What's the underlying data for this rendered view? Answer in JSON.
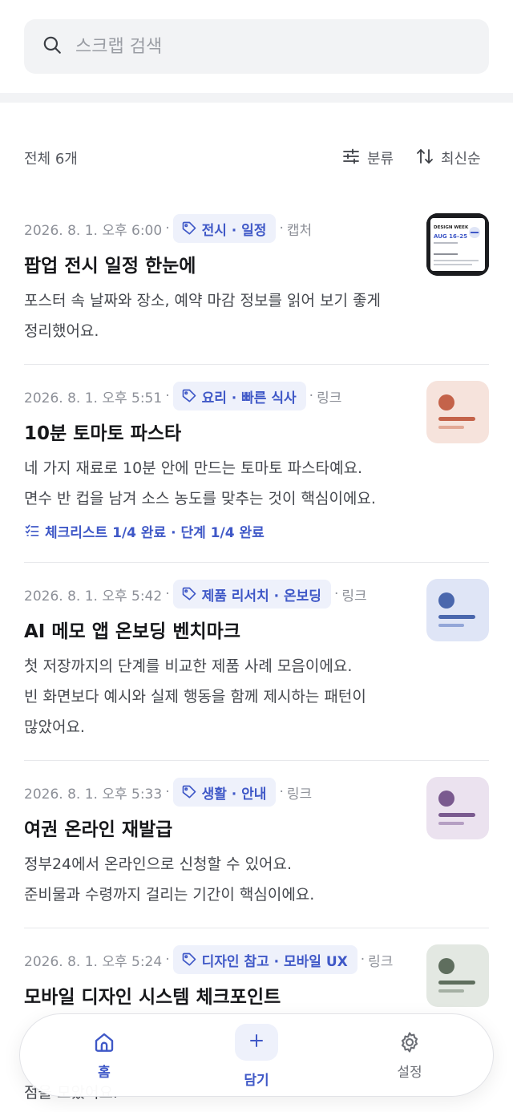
{
  "search": {
    "placeholder": "스크랩 검색"
  },
  "list_header": {
    "total": "전체 6개",
    "filter_label": "분류",
    "sort_label": "최신순"
  },
  "cards": [
    {
      "time": "2026. 8. 1. 오후 6:00",
      "tag": "전시 · 일정",
      "source": "캡처",
      "title": "팝업 전시 일정 한눈에",
      "summary_lines": [
        "포스터 속 날짜와 장소, 예약 마감 정보를 읽어 보기 좋게",
        "정리했어요."
      ],
      "thumb": {
        "kind": "poster",
        "poster_title": "DESIGN WEEK",
        "poster_date": "AUG 16–25"
      }
    },
    {
      "time": "2026. 8. 1. 오후 5:51",
      "tag": "요리 · 빠른 식사",
      "source": "링크",
      "title": "10분 토마토 파스타",
      "summary_lines": [
        "네 가지 재료로 10분 안에 만드는 토마토 파스타예요.",
        "면수 반 컵을 남겨 소스 농도를 맞추는 것이 핵심이에요."
      ],
      "progress": "체크리스트 1/4 완료 · 단계 1/4 완료",
      "thumb": {
        "kind": "icon",
        "bg": "#f6e3dc",
        "accent": "#c4634a",
        "line2": "#e2a895"
      }
    },
    {
      "time": "2026. 8. 1. 오후 5:42",
      "tag": "제품 리서치 · 온보딩",
      "source": "링크",
      "title": "AI 메모 앱 온보딩 벤치마크",
      "summary_lines": [
        "첫 저장까지의 단계를 비교한 제품 사례 모음이에요.",
        "빈 화면보다 예시와 실제 행동을 함께 제시하는 패턴이",
        "많았어요."
      ],
      "thumb": {
        "kind": "icon",
        "bg": "#dfe5f6",
        "accent": "#4a67ad",
        "line2": "#93a6d8"
      }
    },
    {
      "time": "2026. 8. 1. 오후 5:33",
      "tag": "생활 · 안내",
      "source": "링크",
      "title": "여권 온라인 재발급",
      "summary_lines": [
        "정부24에서 온라인으로 신청할 수 있어요.",
        "준비물과 수령까지 걸리는 기간이 핵심이에요."
      ],
      "thumb": {
        "kind": "icon",
        "bg": "#ebe2ef",
        "accent": "#7a5a8f",
        "line2": "#b59fc3"
      }
    },
    {
      "time": "2026. 8. 1. 오후 5:24",
      "tag": "디자인 참고 · 모바일 UX",
      "source": "링크",
      "title": "모바일 디자인 시스템 체크포인트",
      "summary_lines": [
        "",
        "",
        "점을 모았어요."
      ],
      "thumb": {
        "kind": "icon",
        "bg": "#e3e8e2",
        "accent": "#5f6e5e",
        "line2": "#a5b0a4"
      }
    }
  ],
  "nav": {
    "home": "홈",
    "add": "담기",
    "settings": "설정"
  },
  "colors": {
    "accent": "#3f58c7",
    "chip_bg": "#eef1fb"
  }
}
